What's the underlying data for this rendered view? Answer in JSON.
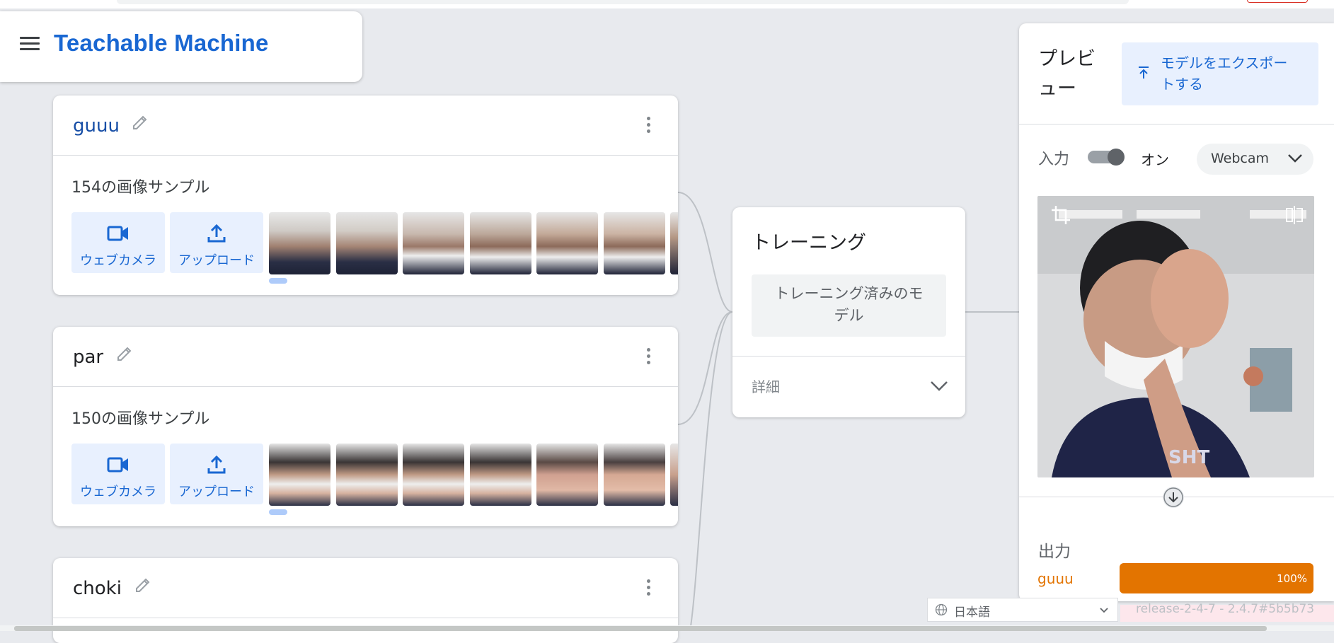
{
  "app": {
    "title": "Teachable Machine"
  },
  "classes": [
    {
      "name": "guuu",
      "samples": "154の画像サンプル",
      "webcam_label": "ウェブカメラ",
      "upload_label": "アップロード"
    },
    {
      "name": "par",
      "samples": "150の画像サンプル",
      "webcam_label": "ウェブカメラ",
      "upload_label": "アップロード"
    },
    {
      "name": "choki"
    }
  ],
  "training": {
    "title": "トレーニング",
    "button_line1": "トレーニング済みのモ",
    "button_line2": "デル",
    "advanced": "詳細"
  },
  "preview": {
    "title_line1": "プレビ",
    "title_line2": "ュー",
    "export_line1": "モデルをエクスポー",
    "export_line2": "トする",
    "input_label": "入力",
    "toggle_state": "オン",
    "source": "Webcam",
    "output_label": "出力",
    "output": {
      "class": "guuu",
      "percent_label": "100%",
      "confidence": 1.0
    }
  },
  "footer": {
    "language": "日本語",
    "release": "release-2-4-7 - 2.4.7#5b5b73"
  },
  "colors": {
    "brand": "#1967d2",
    "output_orange": "#e37400",
    "button_bg": "#e8f0fe"
  },
  "icons": [
    "menu-icon",
    "edit-icon",
    "more-vert-icon",
    "webcam-icon",
    "upload-icon",
    "chevron-down-icon",
    "export-icon",
    "crop-icon",
    "flip-icon",
    "arrow-down-icon",
    "globe-icon"
  ]
}
